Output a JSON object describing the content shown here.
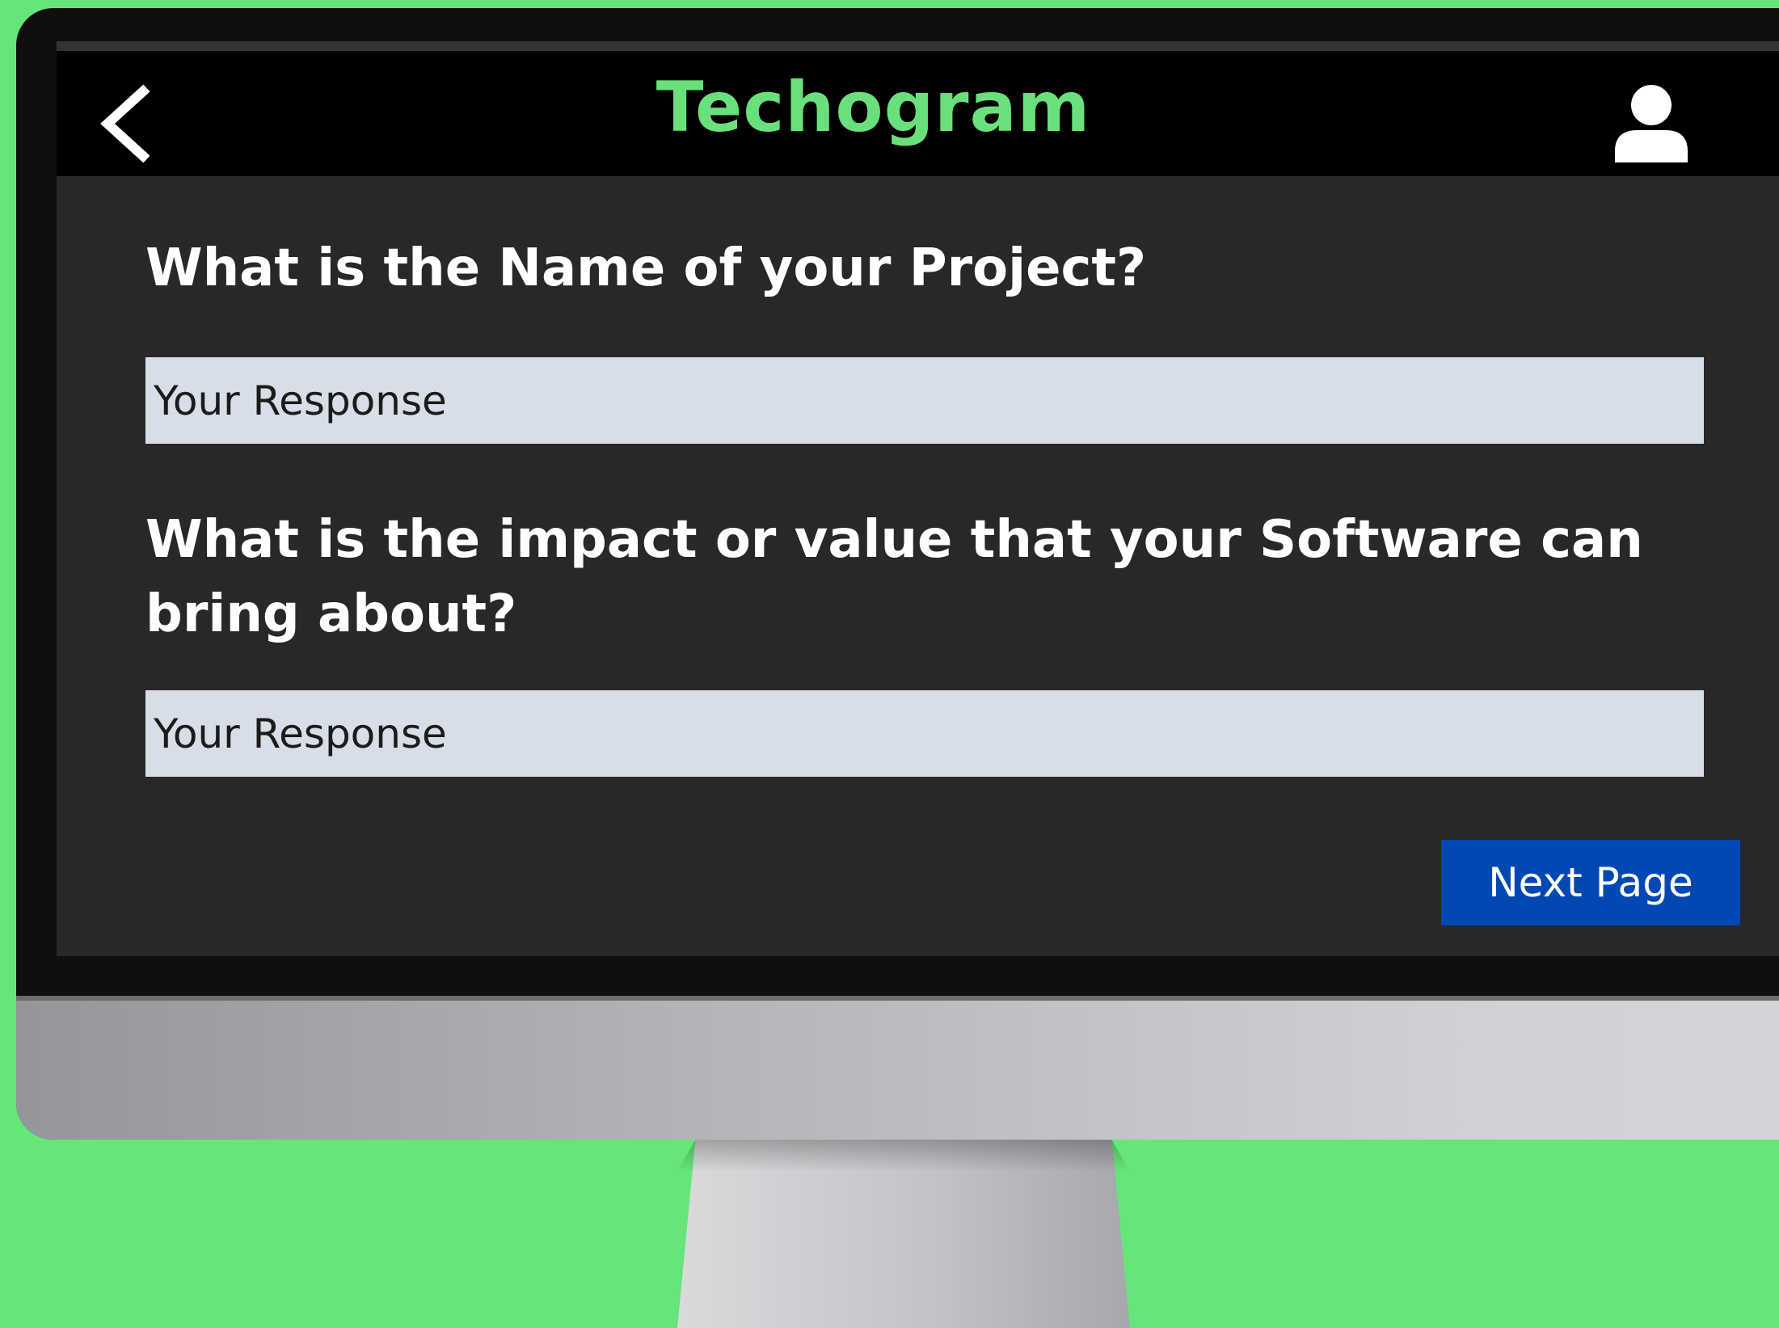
{
  "app": {
    "title": "Techogram"
  },
  "form": {
    "question_1": "What is the Name of your Project?",
    "response_1_placeholder": "Your Response",
    "question_2": "What is the impact or value that your Software can bring about?",
    "response_2_placeholder": "Your Response",
    "next_label": "Next Page"
  },
  "colors": {
    "background": "#66e57a",
    "title_accent": "#6ae07d",
    "screen_bg": "#282828",
    "header_bg": "#000000",
    "input_bg": "#d8dee7",
    "button_bg": "#0248b2"
  },
  "icons": {
    "back": "chevron-left-icon",
    "profile": "user-icon"
  }
}
